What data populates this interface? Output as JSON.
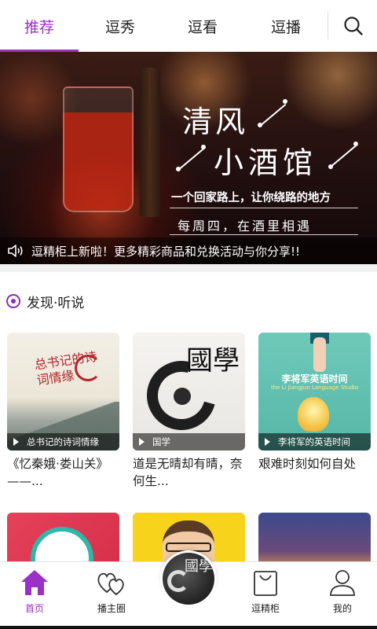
{
  "top_tabs": [
    {
      "label": "推荐",
      "active": true
    },
    {
      "label": "逗秀",
      "active": false
    },
    {
      "label": "逗看",
      "active": false
    },
    {
      "label": "逗播",
      "active": false
    }
  ],
  "banner": {
    "title_line1": "清风",
    "title_line2": "小酒馆",
    "subtitle_line1": "一个回家路上，让你绕路的地方",
    "subtitle_line2": "每周四，在酒里相遇",
    "notice_text": "逗精柜上新啦！更多精彩商品和兑换活动与你分享!!"
  },
  "section": {
    "title": "发现·听说"
  },
  "cards": [
    {
      "image_text": "总书记的诗词情缘",
      "caption": "总书记的诗词情缘",
      "title": "《忆秦娥·娄山关》——..."
    },
    {
      "image_text": "國學",
      "caption": "国学",
      "title": "道是无晴却有晴，奈何生..."
    },
    {
      "image_text_line1": "李将军英语时间",
      "image_text_line2": "the Li Jiangjun Language Studio",
      "caption": "李将军的英语时间",
      "title": "艰难时刻如何自处"
    }
  ],
  "bottom_nav": [
    {
      "label": "首页",
      "icon": "home-icon",
      "active": true
    },
    {
      "label": "播主圈",
      "icon": "hearts-icon",
      "active": false
    },
    {
      "label": "",
      "icon": "guoxue-center-icon",
      "active": false
    },
    {
      "label": "逗精柜",
      "icon": "shopping-bag-icon",
      "active": false
    },
    {
      "label": "我的",
      "icon": "user-icon",
      "active": false
    }
  ],
  "center_button_text": "國學",
  "colors": {
    "accent": "#9b2fc6",
    "divider": "#f1f1f1"
  }
}
